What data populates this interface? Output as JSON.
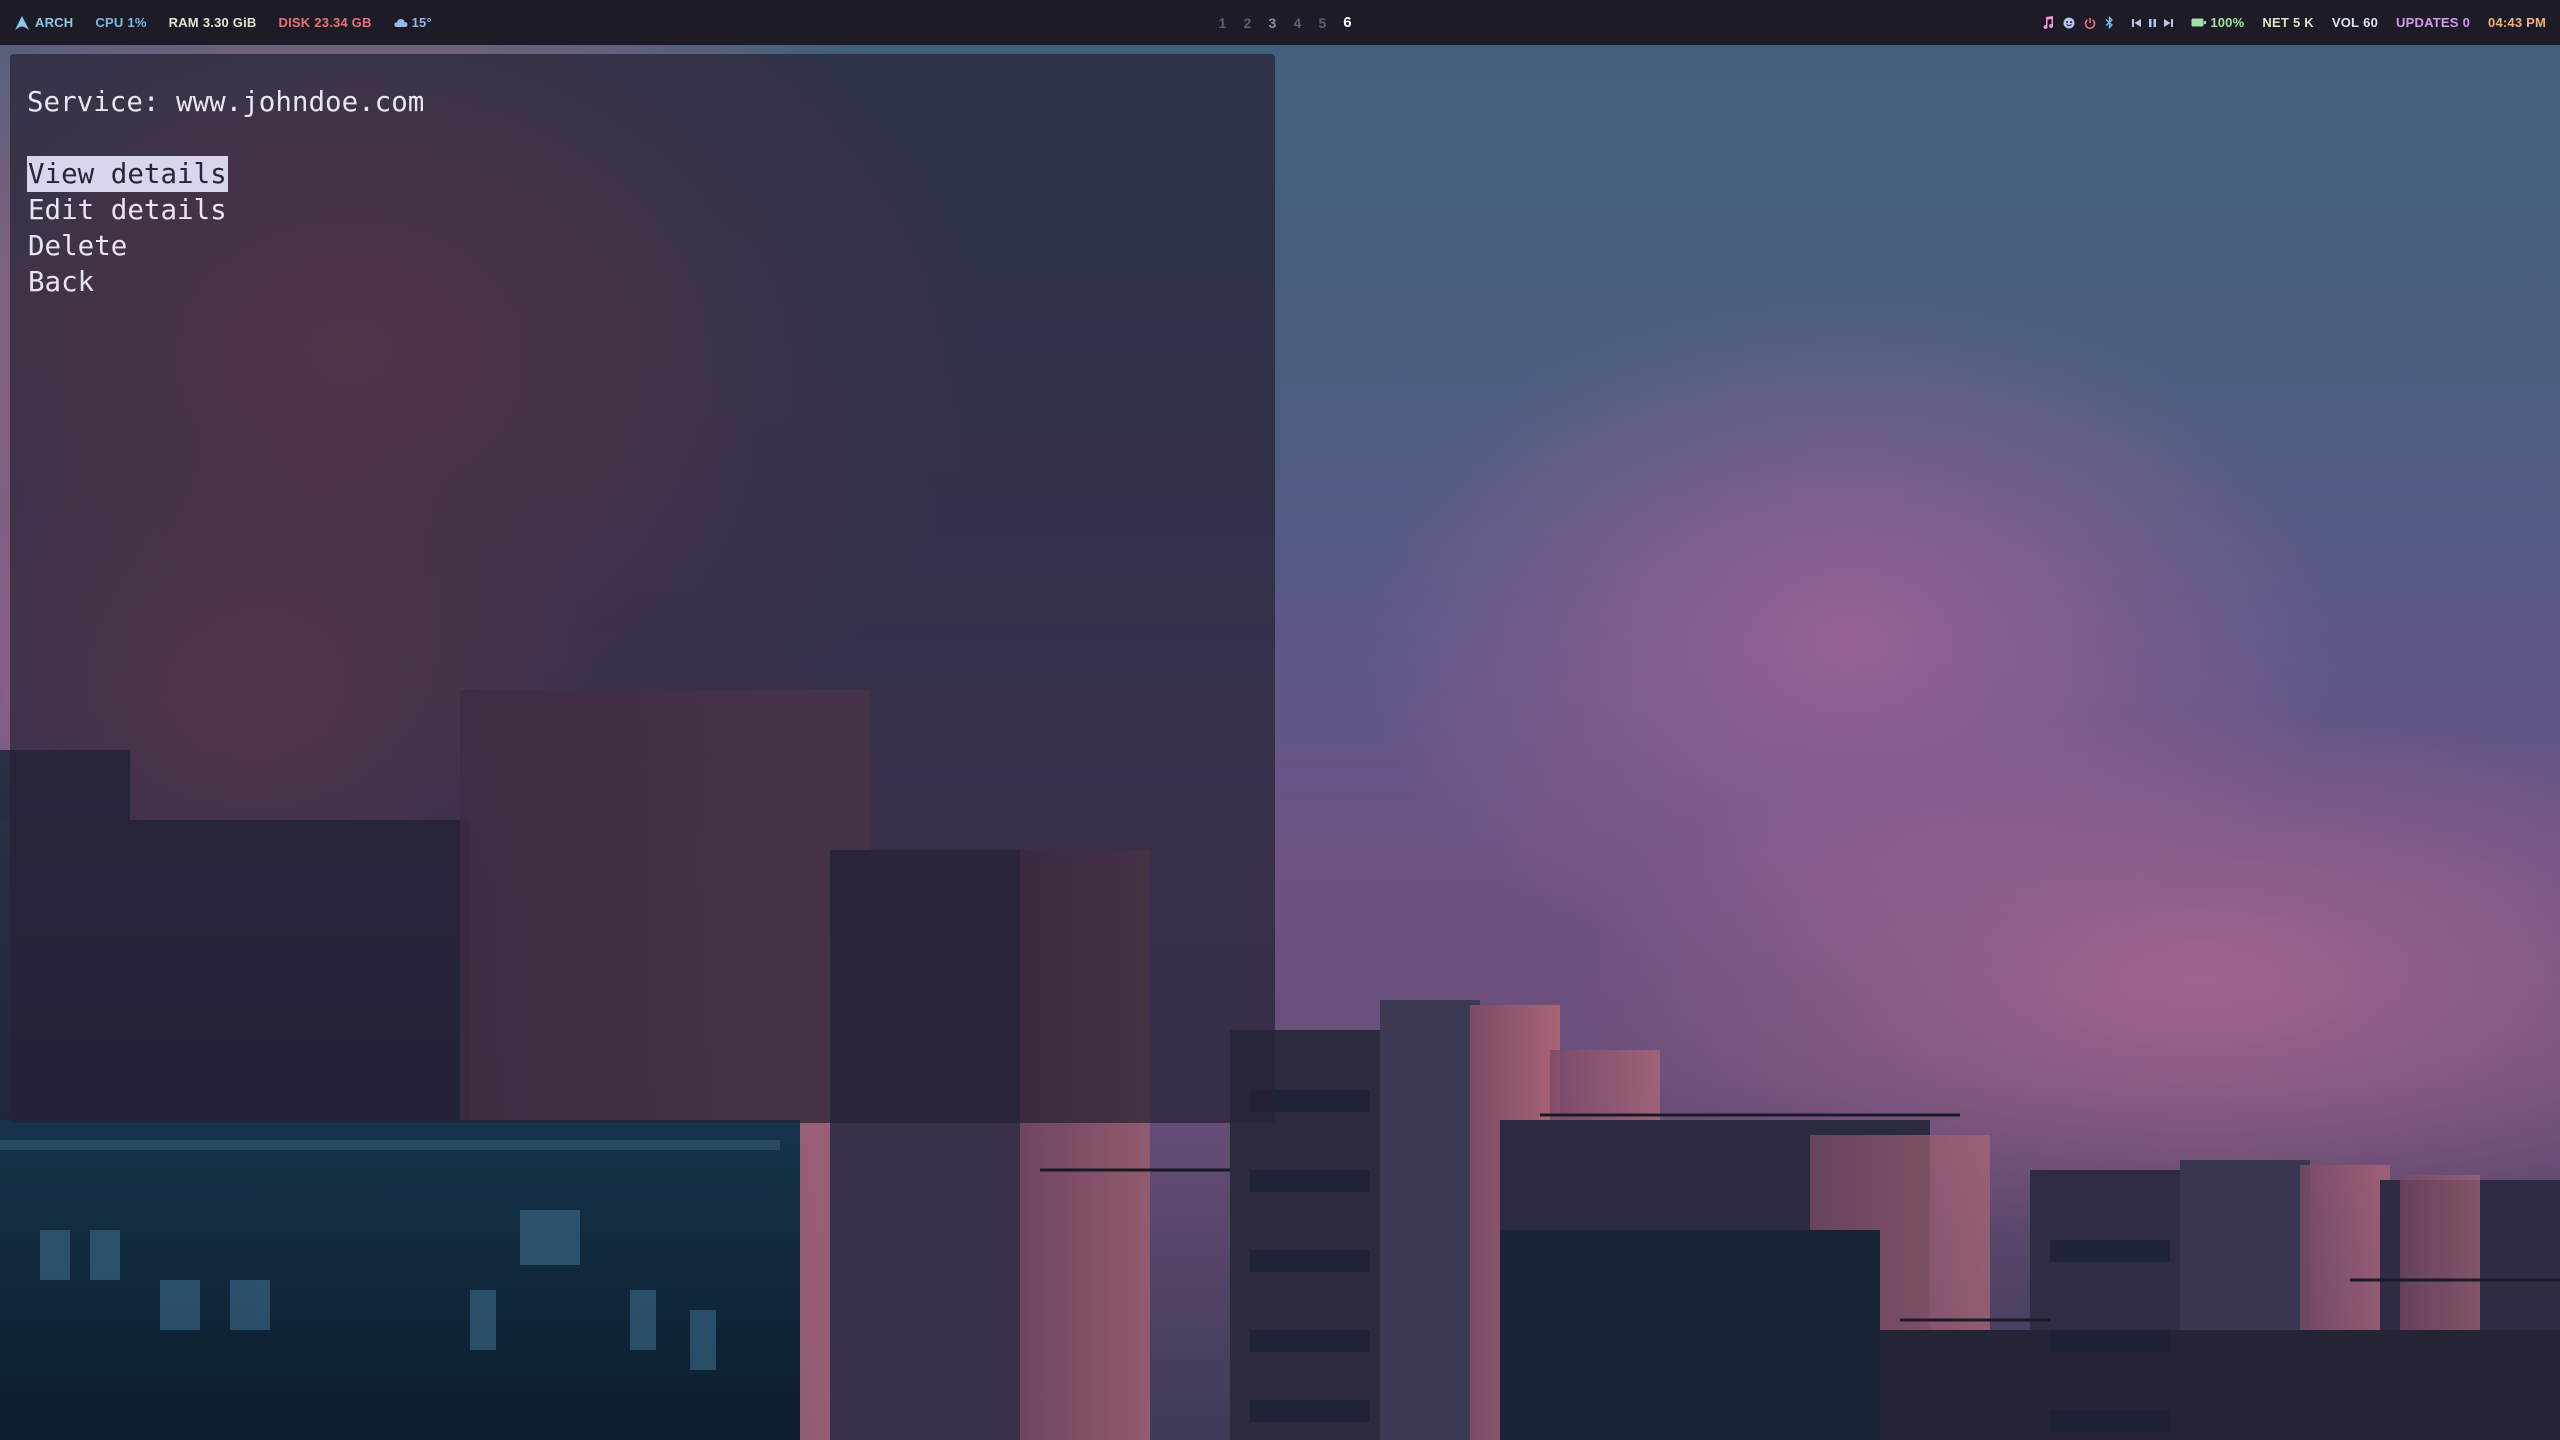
{
  "topbar": {
    "left": {
      "distro": {
        "icon": "arch-linux-icon",
        "label": "ARCH"
      },
      "cpu": {
        "label": "CPU",
        "value": "1%"
      },
      "ram": {
        "label": "RAM",
        "value": "3.30 GiB"
      },
      "disk": {
        "label": "DISK",
        "value": "23.34 GB"
      },
      "weather": {
        "icon": "cloud-icon",
        "value": "15°"
      }
    },
    "workspaces": [
      {
        "label": "1",
        "state": "empty"
      },
      {
        "label": "2",
        "state": "empty"
      },
      {
        "label": "3",
        "state": "occupied"
      },
      {
        "label": "4",
        "state": "empty"
      },
      {
        "label": "5",
        "state": "empty"
      },
      {
        "label": "6",
        "state": "active"
      }
    ],
    "right": {
      "tray_icons": [
        "music-note-icon",
        "face-icon",
        "power-icon",
        "bluetooth-icon"
      ],
      "media": [
        "previous-icon",
        "pause-icon",
        "next-icon"
      ],
      "battery": {
        "icon": "battery-icon",
        "value": "100%"
      },
      "net": {
        "label": "NET",
        "value": "5 K"
      },
      "volume": {
        "label": "VOL",
        "value": "60"
      },
      "updates": {
        "label": "UPDATES",
        "value": "0"
      },
      "clock": "04:43 PM"
    }
  },
  "menu": {
    "prompt": "Service: www.johndoe.com",
    "items": [
      {
        "label": "View details",
        "selected": true
      },
      {
        "label": "Edit details",
        "selected": false
      },
      {
        "label": "Delete",
        "selected": false
      },
      {
        "label": "Back",
        "selected": false
      }
    ]
  },
  "colors": {
    "bar_background": "#1c1b26",
    "menu_background": "#262134",
    "selection_background": "#d9d5eb",
    "clock": "#f2b07a",
    "disk": "#ef6f7c",
    "updates": "#d39af0"
  }
}
